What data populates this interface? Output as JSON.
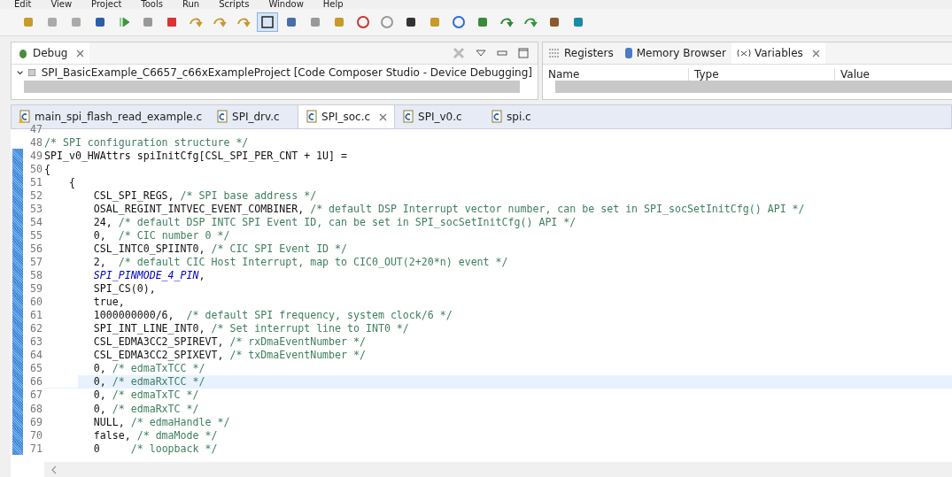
{
  "menu": [
    "Edit",
    "View",
    "Project",
    "Tools",
    "Run",
    "Scripts",
    "Window",
    "Help"
  ],
  "toolbar": [
    {
      "selected": false
    },
    {
      "selected": false
    },
    {
      "selected": false
    },
    {
      "selected": false
    },
    {
      "selected": false
    },
    {
      "selected": false
    },
    {
      "selected": false
    },
    {
      "selected": false
    },
    {
      "selected": false
    },
    {
      "selected": false
    },
    {
      "selected": true
    },
    {
      "selected": false
    },
    {
      "selected": false
    },
    {
      "selected": false
    },
    {
      "selected": false
    },
    {
      "selected": false
    },
    {
      "selected": false
    },
    {
      "selected": false
    },
    {
      "selected": false
    },
    {
      "selected": false
    },
    {
      "selected": false
    },
    {
      "selected": false
    },
    {
      "selected": false
    },
    {
      "selected": false
    }
  ],
  "debug_view": {
    "title": "Debug",
    "session": "SPI_BasicExample_C6657_c66xExampleProject [Code Composer Studio - Device Debugging]"
  },
  "right_view": {
    "tabs": [
      {
        "label": "Registers",
        "selected": false
      },
      {
        "label": "Memory Browser",
        "selected": false
      },
      {
        "label": "Variables",
        "selected": true
      }
    ],
    "columns": [
      "Name",
      "Type",
      "Value"
    ]
  },
  "editor_tabs": [
    {
      "label": "main_spi_flash_read_example.c",
      "selected": false,
      "warning": true
    },
    {
      "label": "SPI_drv.c",
      "selected": false,
      "warning": false
    },
    {
      "label": "SPI_soc.c",
      "selected": true,
      "warning": false
    },
    {
      "label": "SPI_v0.c",
      "selected": false,
      "warning": false
    },
    {
      "label": "spi.c",
      "selected": false,
      "warning": false
    }
  ],
  "code": [
    {
      "number": "47",
      "changed": false,
      "current": false
    },
    {
      "number": "48",
      "changed": false,
      "current": false,
      "parts": [
        {
          "kind": "comment",
          "text": "/* SPI configuration structure */"
        }
      ]
    },
    {
      "number": "49",
      "changed": true,
      "current": false,
      "parts": [
        {
          "kind": "code",
          "text": "SPI_v0_HWAttrs spiInitCfg[CSL_SPI_PER_CNT + 1U] ="
        }
      ]
    },
    {
      "number": "50",
      "changed": true,
      "current": false,
      "parts": [
        {
          "kind": "code",
          "text": "{"
        }
      ]
    },
    {
      "number": "51",
      "changed": true,
      "current": false,
      "parts": [
        {
          "kind": "code",
          "text": "    {"
        }
      ]
    },
    {
      "number": "52",
      "changed": true,
      "current": false,
      "parts": [
        {
          "kind": "code",
          "text": "        CSL_SPI_REGS, "
        },
        {
          "kind": "comment",
          "text": "/* SPI base address */"
        }
      ]
    },
    {
      "number": "53",
      "changed": true,
      "current": false,
      "parts": [
        {
          "kind": "code",
          "text": "        OSAL_REGINT_INTVEC_EVENT_COMBINER, "
        },
        {
          "kind": "comment",
          "text": "/* default DSP Interrupt vector number, can be set in SPI_socSetInitCfg() API */"
        }
      ]
    },
    {
      "number": "54",
      "changed": true,
      "current": false,
      "parts": [
        {
          "kind": "code",
          "text": "        24, "
        },
        {
          "kind": "comment",
          "text": "/* default DSP INTC SPI Event ID, can be set in SPI_socSetInitCfg() API */"
        }
      ]
    },
    {
      "number": "55",
      "changed": true,
      "current": false,
      "parts": [
        {
          "kind": "code",
          "text": "        0,  "
        },
        {
          "kind": "comment",
          "text": "/* CIC number 0 */"
        }
      ]
    },
    {
      "number": "56",
      "changed": true,
      "current": false,
      "parts": [
        {
          "kind": "code",
          "text": "        CSL_INTC0_SPIINT0, "
        },
        {
          "kind": "comment",
          "text": "/* CIC SPI Event ID */"
        }
      ]
    },
    {
      "number": "57",
      "changed": true,
      "current": false,
      "parts": [
        {
          "kind": "code",
          "text": "        2,  "
        },
        {
          "kind": "comment",
          "text": "/* default CIC Host Interrupt, map to CIC0_OUT(2+20*n) event */"
        }
      ]
    },
    {
      "number": "58",
      "changed": true,
      "current": false,
      "parts": [
        {
          "kind": "macro",
          "text": "        SPI_PINMODE_4_PIN"
        },
        {
          "kind": "code",
          "text": ","
        }
      ]
    },
    {
      "number": "59",
      "changed": true,
      "current": false,
      "parts": [
        {
          "kind": "code",
          "text": "        SPI_CS(0),"
        }
      ]
    },
    {
      "number": "60",
      "changed": true,
      "current": false,
      "parts": [
        {
          "kind": "code",
          "text": "        true,"
        }
      ]
    },
    {
      "number": "61",
      "changed": true,
      "current": false,
      "parts": [
        {
          "kind": "code",
          "text": "        1000000000/6,  "
        },
        {
          "kind": "comment",
          "text": "/* default SPI frequency, system clock/6 */"
        }
      ]
    },
    {
      "number": "62",
      "changed": true,
      "current": false,
      "parts": [
        {
          "kind": "code",
          "text": "        SPI_INT_LINE_INT0, "
        },
        {
          "kind": "comment",
          "text": "/* Set interrupt line to INT0 */"
        }
      ]
    },
    {
      "number": "63",
      "changed": true,
      "current": false,
      "parts": [
        {
          "kind": "code",
          "text": "        CSL_EDMA3CC2_SPIREVT, "
        },
        {
          "kind": "comment",
          "text": "/* rxDmaEventNumber */"
        }
      ]
    },
    {
      "number": "64",
      "changed": true,
      "current": false,
      "parts": [
        {
          "kind": "code",
          "text": "        CSL_EDMA3CC2_SPIXEVT, "
        },
        {
          "kind": "comment",
          "text": "/* txDmaEventNumber */"
        }
      ]
    },
    {
      "number": "65",
      "changed": true,
      "current": false,
      "parts": [
        {
          "kind": "code",
          "text": "        0, "
        },
        {
          "kind": "comment",
          "text": "/* edmaTxTCC */"
        }
      ]
    },
    {
      "number": "66",
      "changed": true,
      "current": true,
      "parts": [
        {
          "kind": "code",
          "text": "        0, "
        },
        {
          "kind": "comment",
          "text": "/* edmaRxTCC */"
        }
      ]
    },
    {
      "number": "67",
      "changed": true,
      "current": false,
      "parts": [
        {
          "kind": "code",
          "text": "        0, "
        },
        {
          "kind": "comment",
          "text": "/* edmaTxTC */"
        }
      ]
    },
    {
      "number": "68",
      "changed": true,
      "current": false,
      "parts": [
        {
          "kind": "code",
          "text": "        0, "
        },
        {
          "kind": "comment",
          "text": "/* edmaRxTC */"
        }
      ]
    },
    {
      "number": "69",
      "changed": true,
      "current": false,
      "parts": [
        {
          "kind": "code",
          "text": "        NULL, "
        },
        {
          "kind": "comment",
          "text": "/* edmaHandle */"
        }
      ]
    },
    {
      "number": "70",
      "changed": true,
      "current": false,
      "parts": [
        {
          "kind": "code",
          "text": "        false, "
        },
        {
          "kind": "comment",
          "text": "/* dmaMode */"
        }
      ]
    },
    {
      "number": "71",
      "changed": true,
      "current": false,
      "parts": [
        {
          "kind": "code",
          "text": "        0     "
        },
        {
          "kind": "comment",
          "text": "/* loopback */"
        }
      ]
    }
  ]
}
